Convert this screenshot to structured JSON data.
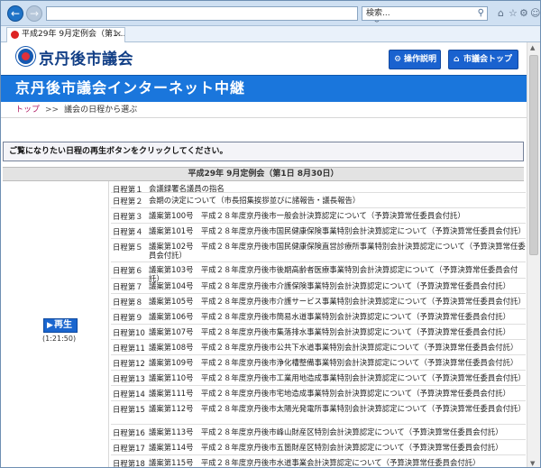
{
  "browser": {
    "address_value": "",
    "search_placeholder": "検索...",
    "tab_title": "平成29年 9月定例会（第1...",
    "toolbar_icons": [
      "home-icon",
      "star-icon",
      "gear-icon",
      "smiley-icon"
    ]
  },
  "site": {
    "logo_text": "京丹後市議会",
    "button_operation": "操作説明",
    "button_top": "市議会トップへ",
    "banner_title": "京丹後市議会インターネット中継"
  },
  "breadcrumb": {
    "home": "トップ",
    "separator": ">>",
    "current": "議会の日程から選ぶ"
  },
  "instruction": "ご覧になりたい日程の再生ボタンをクリックしてください。",
  "session": {
    "title": "平成29年 9月定例会（第1日 8月30日）",
    "play_label": "再生",
    "duration": "(1:21:50)"
  },
  "agenda": [
    {
      "num": "日程第１",
      "text": "会議録署名議員の指名"
    },
    {
      "num": "日程第２",
      "text": "会期の決定について（市長招集挨拶並びに諸報告・議長報告）"
    },
    {
      "num": "日程第３",
      "text": "議案第100号　平成２８年度京丹後市一般会計決算認定について（予算決算常任委員会付託）"
    },
    {
      "num": "日程第４",
      "text": "議案第101号　平成２８年度京丹後市国民健康保険事業特別会計決算認定について（予算決算常任委員会付託）"
    },
    {
      "num": "日程第５",
      "text": "議案第102号　平成２８年度京丹後市国民健康保険直営診療所事業特別会計決算認定について（予算決算常任委員会付託）"
    },
    {
      "num": "日程第６",
      "text": "議案第103号　平成２８年度京丹後市後期高齢者医療事業特別会計決算認定について（予算決算常任委員会付託）"
    },
    {
      "num": "日程第７",
      "text": "議案第104号　平成２８年度京丹後市介護保険事業特別会計決算認定について（予算決算常任委員会付託）"
    },
    {
      "num": "日程第８",
      "text": "議案第105号　平成２８年度京丹後市介護サービス事業特別会計決算認定について（予算決算常任委員会付託）"
    },
    {
      "num": "日程第９",
      "text": "議案第106号　平成２８年度京丹後市簡易水道事業特別会計決算認定について（予算決算常任委員会付託）"
    },
    {
      "num": "日程第10",
      "text": "議案第107号　平成２８年度京丹後市集落排水事業特別会計決算認定について（予算決算常任委員会付託）"
    },
    {
      "num": "日程第11",
      "text": "議案第108号　平成２８年度京丹後市公共下水道事業特別会計決算認定について（予算決算常任委員会付託）"
    },
    {
      "num": "日程第12",
      "text": "議案第109号　平成２８年度京丹後市浄化槽整備事業特別会計決算認定について（予算決算常任委員会付託）"
    },
    {
      "num": "日程第13",
      "text": "議案第110号　平成２８年度京丹後市工業用地造成事業特別会計決算認定について（予算決算常任委員会付託）"
    },
    {
      "num": "日程第14",
      "text": "議案第111号　平成２８年度京丹後市宅地造成事業特別会計決算認定について（予算決算常任委員会付託）"
    },
    {
      "num": "日程第15",
      "text": "議案第112号　平成２８年度京丹後市太陽光発電所事業特別会計決算認定について（予算決算常任委員会付託）"
    },
    {
      "num": "日程第16",
      "text": "議案第113号　平成２８年度京丹後市峰山財産区特別会計決算認定について（予算決算常任委員会付託）"
    },
    {
      "num": "日程第17",
      "text": "議案第114号　平成２８年度京丹後市五箇財産区特別会計決算認定について（予算決算常任委員会付託）"
    },
    {
      "num": "日程第18",
      "text": "議案第115号　平成２８年度京丹後市水道事業会計決算認定について（予算決算常任委員会付託）"
    }
  ]
}
